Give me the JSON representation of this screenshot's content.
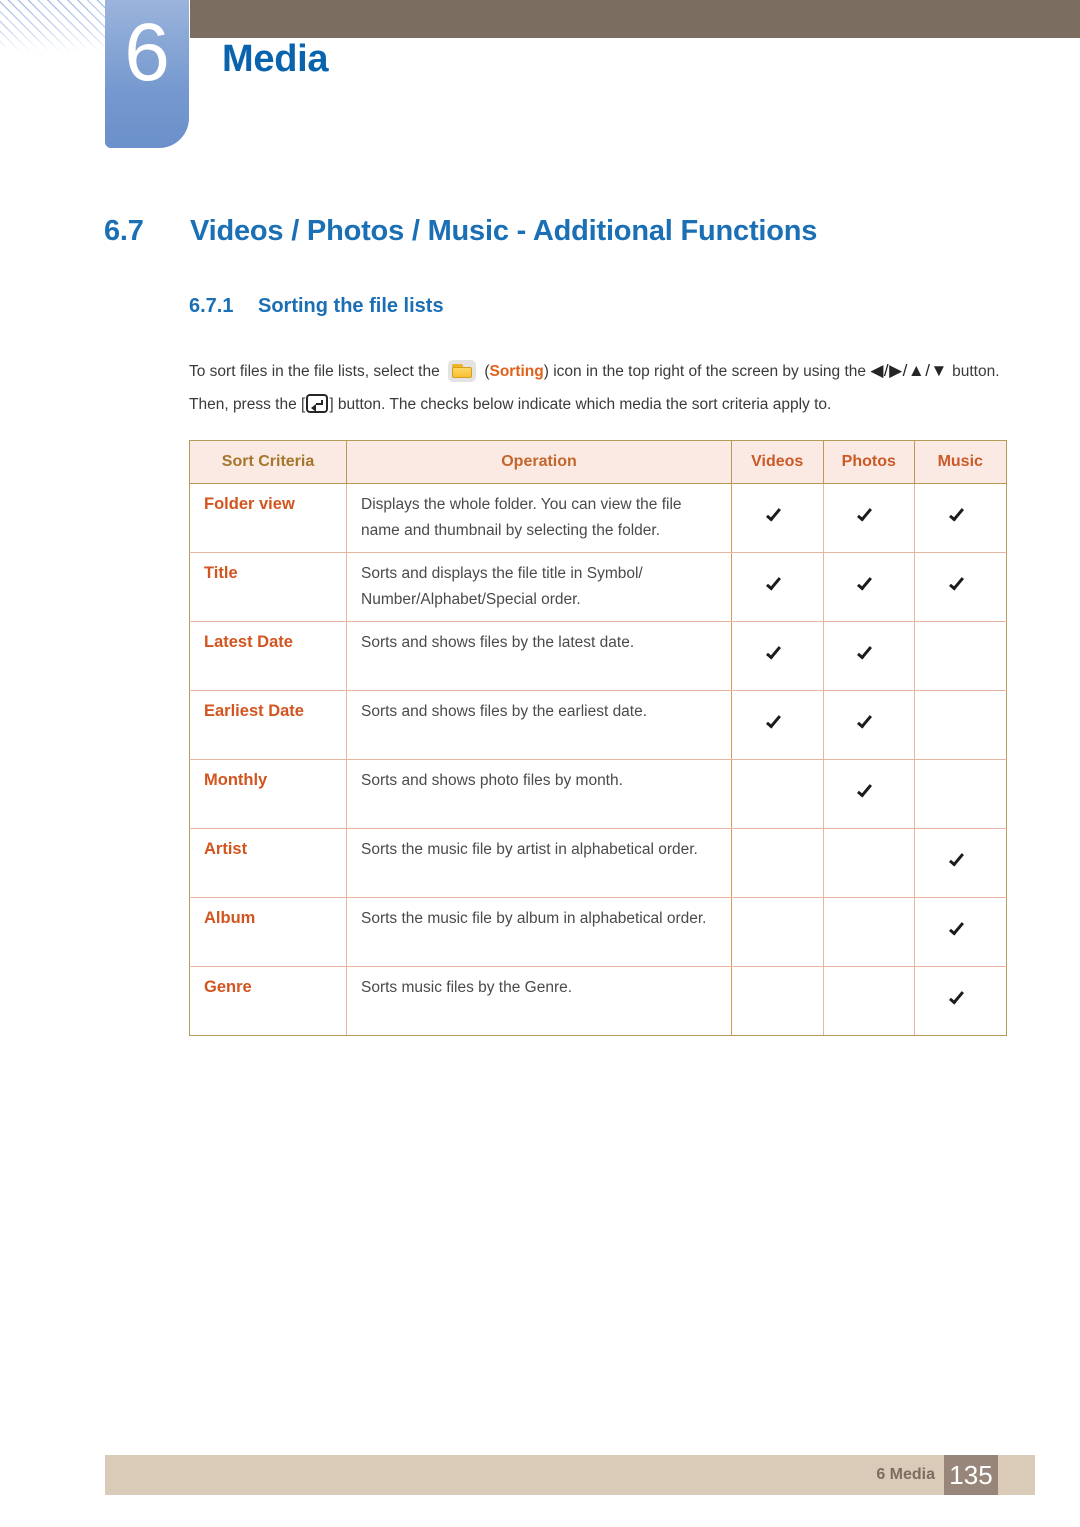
{
  "header": {
    "chapter_number": "6",
    "chapter_title": "Media",
    "accent_blue": "#0a64ad",
    "tab_blue": "#7599cf",
    "bar_brown": "#7b6e60"
  },
  "headings": {
    "section_number": "6.7",
    "section_title": "Videos / Photos / Music - Additional Functions",
    "subsection_number": "6.7.1",
    "subsection_title": "Sorting the file lists"
  },
  "paragraph": {
    "part1": "To sort files in the file lists, select the",
    "sorting_icon_name": "folder-sorting-icon",
    "paren_open": "(",
    "emphasis": "Sorting",
    "paren_close": ")",
    "part2": "icon in the top right of the screen by using the",
    "dpad_glyphs": "◀/▶/▲/▼",
    "part3": "button. Then, press the [",
    "enter_icon_name": "enter-button-icon",
    "part4": "] button. The checks below indicate which media the sort criteria apply to.",
    "emphasis_color": "#e2611a"
  },
  "table": {
    "columns": [
      "Sort Criteria",
      "Operation",
      "Videos",
      "Photos",
      "Music"
    ],
    "header_bg": "#faeae3",
    "header_text_color": "#cb5a27",
    "criteria_text_color": "#d2551f",
    "border_color": "#e7b5a0",
    "check_glyph": "✓",
    "rows": [
      {
        "criteria": "Folder view",
        "operation": "Displays the whole folder. You can view the file name and thumbnail by selecting the folder.",
        "videos": true,
        "photos": true,
        "music": true
      },
      {
        "criteria": "Title",
        "operation": "Sorts and displays the file title in Symbol/ Number/Alphabet/Special order.",
        "videos": true,
        "photos": true,
        "music": true
      },
      {
        "criteria": "Latest Date",
        "operation": "Sorts and shows files by the latest date.",
        "videos": true,
        "photos": true,
        "music": false
      },
      {
        "criteria": "Earliest Date",
        "operation": "Sorts and shows files by the earliest date.",
        "videos": true,
        "photos": true,
        "music": false
      },
      {
        "criteria": "Monthly",
        "operation": "Sorts and shows photo files by month.",
        "videos": false,
        "photos": true,
        "music": false
      },
      {
        "criteria": "Artist",
        "operation": "Sorts the music file by artist in alphabetical order.",
        "videos": false,
        "photos": false,
        "music": true
      },
      {
        "criteria": "Album",
        "operation": "Sorts the music file by album in alphabetical order.",
        "videos": false,
        "photos": false,
        "music": true
      },
      {
        "criteria": "Genre",
        "operation": "Sorts music files by the Genre.",
        "videos": false,
        "photos": false,
        "music": true
      }
    ]
  },
  "footer": {
    "label": "6 Media",
    "page_number": "135",
    "bar_color": "#d9cbb8",
    "page_box_color": "#978679"
  }
}
